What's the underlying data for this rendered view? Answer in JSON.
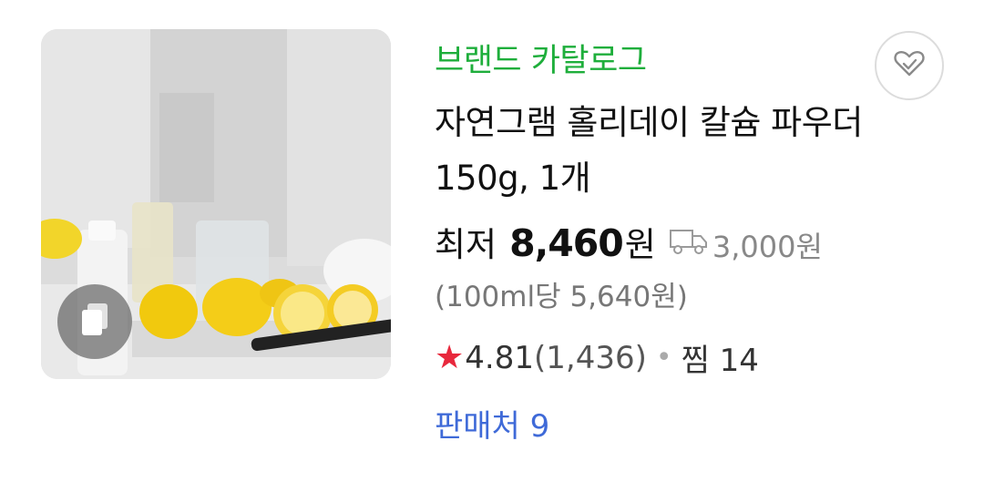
{
  "product": {
    "brand": "브랜드 카탈로그",
    "title": "자연그램 홀리데이 칼슘 파우더 150g, 1개",
    "price_label": "최저",
    "price_value": "8,460",
    "price_unit": "원",
    "shipping_fee": "3,000원",
    "unit_price": "(100ml당 5,640원)",
    "rating_star": "★",
    "rating": "4.81",
    "review_count": "(1,436)",
    "dot": "•",
    "zzim_label": "찜 14",
    "sellers_label": "판매처 9"
  },
  "icons": {
    "shipping": "truck-icon",
    "zzim": "heart-icon",
    "image_badge": "copy-icon"
  },
  "colors": {
    "brand": "#1eae3b",
    "star": "#e8283c",
    "sellers": "#3f6ad8"
  }
}
